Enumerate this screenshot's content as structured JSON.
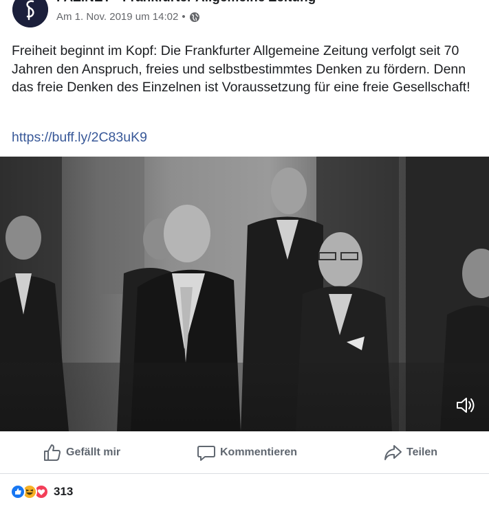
{
  "post": {
    "page_name": "FAZ.NET - Frankfurter Allgemeine Zeitung",
    "timestamp": "Am 1. Nov. 2019 um 14:02",
    "separator": "•",
    "privacy_icon": "globe-icon",
    "text": "Freiheit beginnt im Kopf: Die Frankfurter Allgemeine Zeitung verfolgt seit 70 Jahren den Anspruch, freies und selbstbestimmtes Denken zu fördern. Denn das freie Denken des Einzelnen ist Voraussetzung für eine freie Gesellschaft!",
    "link": "https://buff.ly/2C83uK9"
  },
  "video": {
    "volume_icon": "speaker-icon"
  },
  "actions": {
    "like_label": "Gefällt mir",
    "comment_label": "Kommentieren",
    "share_label": "Teilen"
  },
  "reactions": {
    "icons": [
      "like-reaction-icon",
      "haha-reaction-icon",
      "love-reaction-icon"
    ],
    "count": "313"
  },
  "colors": {
    "link": "#385898",
    "action_text": "#606770",
    "meta_text": "#65676b",
    "like_blue": "#1877f2",
    "love_red": "#f33e58",
    "haha_yellow": "#f7b125"
  }
}
